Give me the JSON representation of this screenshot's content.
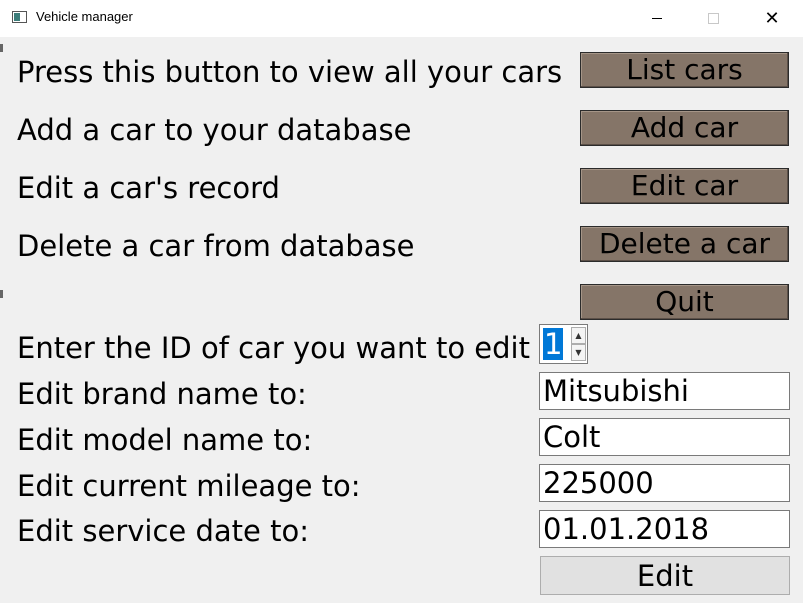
{
  "window": {
    "title": "Vehicle manager",
    "icons": {
      "app": "app-window-icon",
      "minimize": "minimize-icon",
      "maximize": "maximize-icon",
      "close": "close-icon"
    }
  },
  "menu": {
    "list": {
      "label": "Press this button to view all your cars",
      "button": "List cars"
    },
    "add": {
      "label": "Add a car to your database",
      "button": "Add car"
    },
    "edit": {
      "label": "Edit a car's record",
      "button": "Edit car"
    },
    "delete": {
      "label": "Delete a car from database",
      "button": "Delete a car"
    },
    "quit": {
      "button": "Quit"
    }
  },
  "edit_form": {
    "id_label": "Enter the ID of car you want to edit",
    "id_value": "1",
    "brand_label": "Edit brand name to:",
    "brand_value": "Mitsubishi",
    "model_label": "Edit model name to:",
    "model_value": "Colt",
    "mileage_label": "Edit current mileage to:",
    "mileage_value": "225000",
    "service_label": "Edit service date to:",
    "service_value": "01.01.2018",
    "submit": "Edit"
  },
  "colors": {
    "button_brown": "#857568",
    "background": "#f0f0f0",
    "selection": "#0078d7"
  }
}
